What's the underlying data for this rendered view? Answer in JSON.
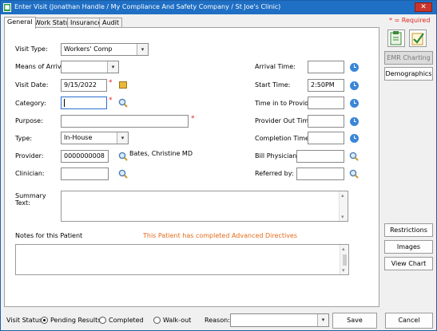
{
  "window": {
    "title": "Enter Visit (Jonathan Handle / My Compliance And Safety Company / St Joe's Clinic)",
    "required_note": "* = Required"
  },
  "tabs": [
    {
      "label": "General",
      "active": true
    },
    {
      "label": "Work Status",
      "active": false
    },
    {
      "label": "Insurance",
      "active": false
    },
    {
      "label": "Audit",
      "active": false
    }
  ],
  "form": {
    "visit_type": {
      "label": "Visit Type:",
      "value": "Workers' Comp"
    },
    "means_of_arrival": {
      "label": "Means of Arrival:",
      "value": ""
    },
    "visit_date": {
      "label": "Visit Date:",
      "value": "9/15/2022"
    },
    "category": {
      "label": "Category:",
      "value": ""
    },
    "purpose": {
      "label": "Purpose:",
      "value": ""
    },
    "type": {
      "label": "Type:",
      "value": "In-House"
    },
    "provider": {
      "label": "Provider:",
      "value": "0000000008",
      "name": "Bates, Christine  MD"
    },
    "clinician": {
      "label": "Clinician:",
      "value": ""
    },
    "arrival_time": {
      "label": "Arrival Time:",
      "value": ""
    },
    "start_time": {
      "label": "Start Time:",
      "value": "2:50PM"
    },
    "time_in_to_provider": {
      "label": "Time in to Provider:",
      "value": ""
    },
    "provider_out_time": {
      "label": "Provider Out Time:",
      "value": ""
    },
    "completion_time": {
      "label": "Completion Time:",
      "value": ""
    },
    "bill_physician": {
      "label": "Bill Physician:",
      "value": ""
    },
    "referred_by": {
      "label": "Referred by:",
      "value": ""
    },
    "summary_text": {
      "label_line1": "Summary",
      "label_line2": "Text:",
      "value": ""
    },
    "notes_label": "Notes for this Patient",
    "advanced_directives_msg": "This Patient has completed Advanced Directives",
    "required_mark": "*"
  },
  "sidebar": {
    "emr_charting": "EMR Charting",
    "demographics": "Demographics",
    "restrictions": "Restrictions",
    "images": "Images",
    "view_chart": "View Chart"
  },
  "statusbar": {
    "visit_status_label": "Visit Status:",
    "options": [
      "Pending Results",
      "Completed",
      "Walk-out"
    ],
    "selected": "Pending Results",
    "reason_label": "Reason:",
    "reason_value": "",
    "save": "Save",
    "cancel": "Cancel"
  },
  "colors": {
    "titlebar": "#1f6fc4",
    "required": "#e0261c",
    "advanced_directives": "#e46a1a",
    "icon_blue": "#3a86d8"
  }
}
